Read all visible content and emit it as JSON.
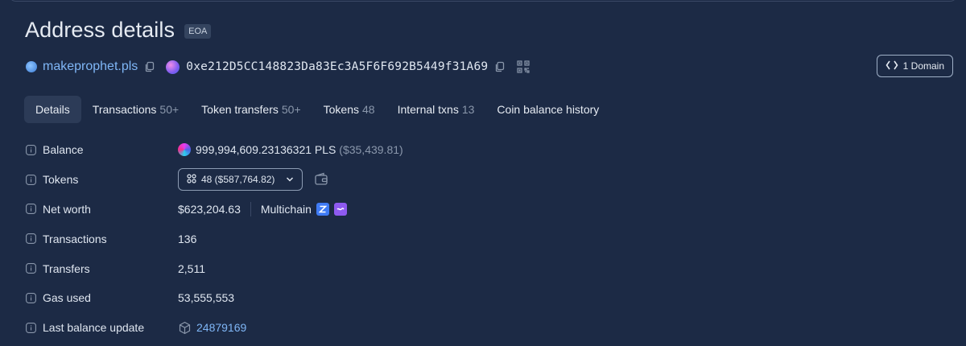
{
  "header": {
    "title": "Address details",
    "badge": "EOA"
  },
  "address_row": {
    "ens_name": "makeprophet.pls",
    "address": "0xe212D5CC148823Da83Ec3A5F6F692B5449f31A69",
    "domain_button": "1 Domain"
  },
  "tabs": [
    {
      "label": "Details",
      "count": ""
    },
    {
      "label": "Transactions",
      "count": "50+"
    },
    {
      "label": "Token transfers",
      "count": "50+"
    },
    {
      "label": "Tokens",
      "count": "48"
    },
    {
      "label": "Internal txns",
      "count": "13"
    },
    {
      "label": "Coin balance history",
      "count": ""
    }
  ],
  "details": {
    "balance": {
      "label": "Balance",
      "value": "999,994,609.23136321 PLS",
      "usd": "($35,439.81)"
    },
    "tokens": {
      "label": "Tokens",
      "value": "48 ($587,764.82)"
    },
    "net_worth": {
      "label": "Net worth",
      "value": "$623,204.63",
      "multichain": "Multichain"
    },
    "transactions": {
      "label": "Transactions",
      "value": "136"
    },
    "transfers": {
      "label": "Transfers",
      "value": "2,511"
    },
    "gas_used": {
      "label": "Gas used",
      "value": "53,555,553"
    },
    "last_balance_update": {
      "label": "Last balance update",
      "value": "24879169"
    }
  },
  "colors": {
    "background": "#1c2a45",
    "link": "#7fb6f6",
    "active_tab": "#2c3b57"
  }
}
